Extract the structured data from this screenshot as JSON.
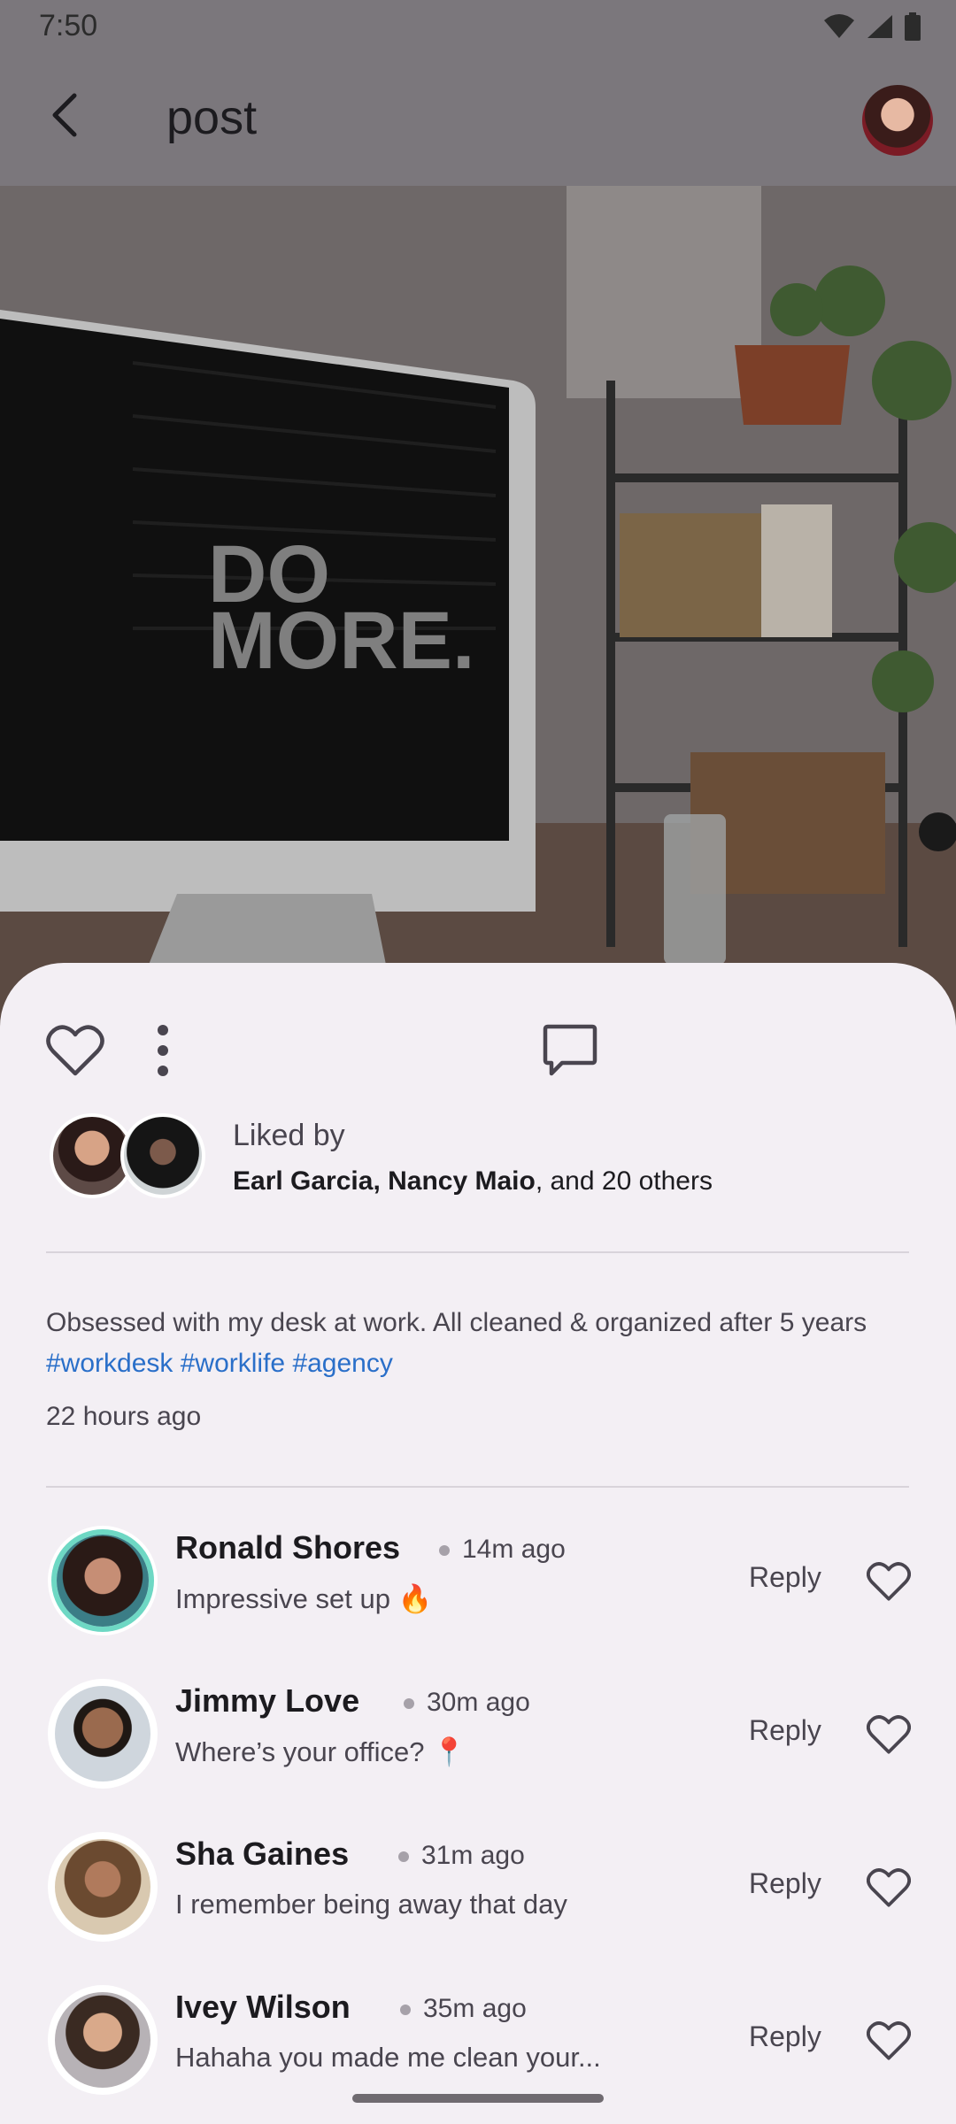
{
  "status_bar": {
    "time": "7:50"
  },
  "app_bar": {
    "title": "post"
  },
  "hero": {
    "screen_text_line1": "DO",
    "screen_text_line2": "MORE."
  },
  "likes": {
    "label": "Liked by",
    "names": "Earl Garcia, Nancy Maio",
    "rest": ", and 20 others"
  },
  "post": {
    "caption": "Obsessed with my desk at work. All cleaned & organized after 5 years",
    "tags": "#workdesk #worklife #agency",
    "time_ago": "22 hours ago"
  },
  "comments": [
    {
      "name": "Ronald Shores",
      "time": "14m ago",
      "text": "Impressive set up 🔥",
      "reply": "Reply"
    },
    {
      "name": "Jimmy Love",
      "time": "30m ago",
      "text": "Where’s your office? 📍",
      "reply": "Reply"
    },
    {
      "name": "Sha Gaines",
      "time": "31m ago",
      "text": "I remember being away that day",
      "reply": "Reply"
    },
    {
      "name": "Ivey Wilson",
      "time": "35m ago",
      "text": "Hahaha you made me clean your...",
      "reply": "Reply"
    }
  ],
  "colors": {
    "accent_link": "#2a6fc9",
    "surface": "#f3eff4",
    "scrim": "#7b777c"
  },
  "icons": [
    "wifi-icon",
    "signal-icon",
    "battery-icon",
    "back-arrow-icon",
    "heart-icon",
    "comment-icon",
    "more-vert-icon"
  ]
}
